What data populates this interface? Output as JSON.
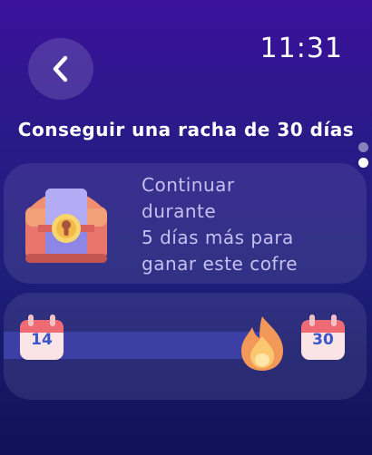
{
  "status_bar": {
    "time": "11:31"
  },
  "header": {
    "back_icon": "chevron-left-icon"
  },
  "title": "Conseguir una racha de 30 días",
  "pager": {
    "count": 2,
    "active_index": 1
  },
  "reward": {
    "icon": "treasure-chest-icon",
    "lines": [
      "Continuar",
      "durante",
      "5 días más para",
      "ganar este cofre"
    ]
  },
  "streak": {
    "start_day": "14",
    "end_day": "30",
    "start_icon": "calendar-icon",
    "end_icon": "calendar-icon",
    "marker_icon": "flame-icon",
    "progress": 0.83
  },
  "colors": {
    "background_top": "#3a119a",
    "background_bottom": "#101256",
    "reward_text": "#c6bff0",
    "track": "#3c40a4",
    "calendar_number": "#3955c7",
    "flame": "#f4a35a"
  }
}
